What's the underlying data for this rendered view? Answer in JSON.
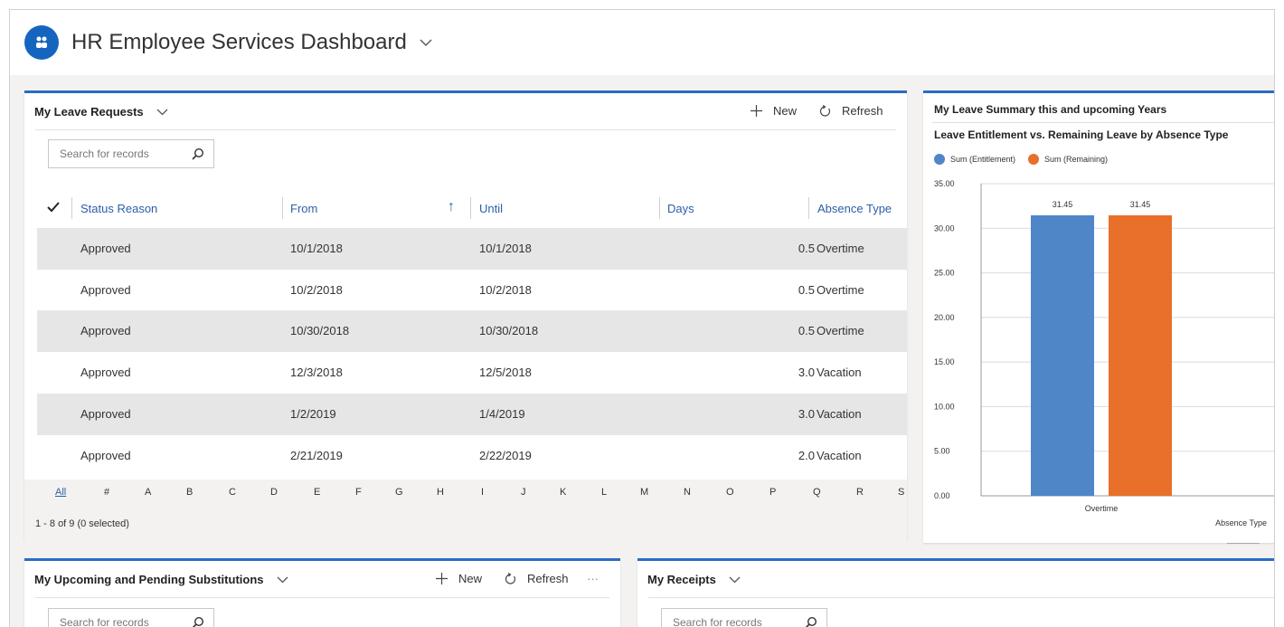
{
  "header": {
    "title": "HR Employee Services Dashboard",
    "logo_icon": "hr-people-icon"
  },
  "leave_requests": {
    "title": "My Leave Requests",
    "new_label": "New",
    "refresh_label": "Refresh",
    "search_placeholder": "Search for records",
    "columns": [
      "Status Reason",
      "From",
      "Until",
      "Days",
      "Absence Type"
    ],
    "sort_indicator": "↑",
    "rows": [
      {
        "status": "Approved",
        "from": "10/1/2018",
        "until": "10/1/2018",
        "days": "0.5",
        "type": "Overtime"
      },
      {
        "status": "Approved",
        "from": "10/2/2018",
        "until": "10/2/2018",
        "days": "0.5",
        "type": "Overtime"
      },
      {
        "status": "Approved",
        "from": "10/30/2018",
        "until": "10/30/2018",
        "days": "0.5",
        "type": "Overtime"
      },
      {
        "status": "Approved",
        "from": "12/3/2018",
        "until": "12/5/2018",
        "days": "3.0",
        "type": "Vacation"
      },
      {
        "status": "Approved",
        "from": "1/2/2019",
        "until": "1/4/2019",
        "days": "3.0",
        "type": "Vacation"
      },
      {
        "status": "Approved",
        "from": "2/21/2019",
        "until": "2/22/2019",
        "days": "2.0",
        "type": "Vacation"
      }
    ],
    "alpha_filter": [
      "All",
      "#",
      "A",
      "B",
      "C",
      "D",
      "E",
      "F",
      "G",
      "H",
      "I",
      "J",
      "K",
      "L",
      "M",
      "N",
      "O",
      "P",
      "Q",
      "R",
      "S"
    ],
    "record_count": "1 - 8 of 9 (0 selected)"
  },
  "leave_summary": {
    "title": "My Leave Summary this and upcoming Years",
    "chart_title": "Leave Entitlement vs. Remaining Leave by Absence Type"
  },
  "chart_data": {
    "type": "bar",
    "categories": [
      "Overtime"
    ],
    "series": [
      {
        "name": "Sum (Entitlement)",
        "values": [
          31.45
        ],
        "color": "#4e86c8"
      },
      {
        "name": "Sum (Remaining)",
        "values": [
          31.45
        ],
        "color": "#e8702a"
      }
    ],
    "data_labels": [
      "31.45",
      "31.45"
    ],
    "title": "Leave Entitlement vs. Remaining Leave by Absence Type",
    "xlabel": "Absence Type",
    "ylabel": "",
    "ylim": [
      0,
      35
    ],
    "yticks": [
      "0.00",
      "5.00",
      "10.00",
      "15.00",
      "20.00",
      "25.00",
      "30.00",
      "35.00"
    ],
    "grid": true,
    "legend": "top-left"
  },
  "substitutions": {
    "title": "My Upcoming and Pending Substitutions",
    "new_label": "New",
    "refresh_label": "Refresh",
    "more_label": "···",
    "search_placeholder": "Search for records"
  },
  "receipts": {
    "title": "My Receipts",
    "search_placeholder": "Search for records"
  },
  "colors": {
    "accent": "#2b6cc4",
    "link": "#2b5fa8",
    "logo": "#1565c0",
    "row_shade": "#e6e6e6"
  }
}
